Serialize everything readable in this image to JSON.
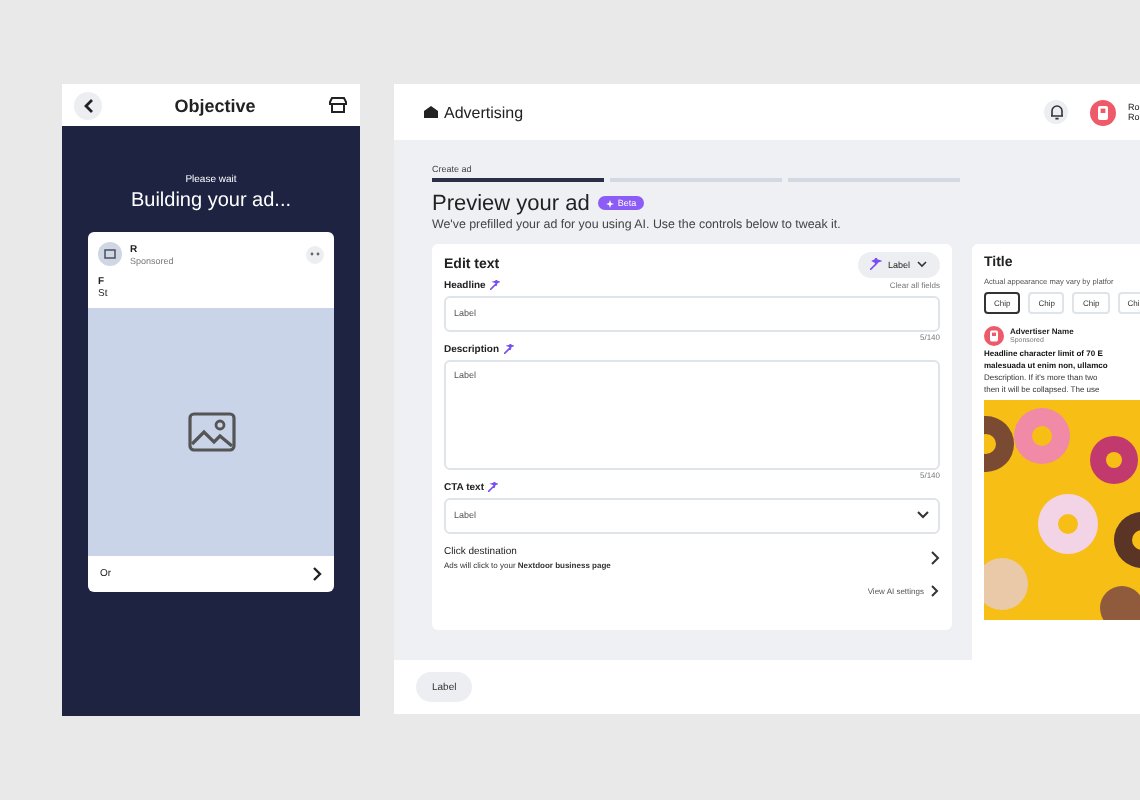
{
  "phone": {
    "title": "Objective",
    "wait_text": "Please wait",
    "heading": "Building your ad...",
    "card": {
      "name": "R",
      "meta": "Sponsored",
      "line_1": "F",
      "line_2": "St",
      "image": {
        "kind": "placeholder"
      },
      "footer": "Or"
    }
  },
  "header": {
    "title": "Advertising",
    "user_name": "Ro",
    "user_meta": "Ro"
  },
  "steps": {
    "label": "Create ad",
    "items": [
      {
        "selected": true
      },
      {
        "selected": false
      },
      {
        "selected": false
      }
    ]
  },
  "page": {
    "title": "Preview your ad",
    "badge": "Beta",
    "subtitle": "We've prefilled your ad for you using AI. Use the controls  below to tweak it."
  },
  "edit": {
    "title": "Edit text",
    "menu_label": "Label",
    "clear": "Clear all fields",
    "fields": [
      {
        "kind": "input",
        "label": "Headline",
        "value": "Label",
        "counter": "5/140"
      },
      {
        "kind": "textarea",
        "label": "Description",
        "value": "Label",
        "counter": "5/140"
      },
      {
        "kind": "select",
        "label": "CTA text",
        "value": "Label"
      }
    ],
    "destination": {
      "title": "Click destination",
      "text": "Ads will click to your **Nextdoor business page**"
    },
    "ai_link": "View AI settings"
  },
  "preview": {
    "title": "Title",
    "note": "Actual appearance may vary by platfor",
    "chips": [
      {
        "label": "Chip",
        "selected": true
      },
      {
        "label": "Chip",
        "selected": false
      },
      {
        "label": "Chip",
        "selected": false
      },
      {
        "label": "Chi",
        "selected": false
      }
    ],
    "advertiser": "Advertiser Name",
    "sponsored": "Sponsored",
    "headline_lines": [
      "Headline character limit of 70 E",
      "malesuada ut enim non, ullamco"
    ],
    "description_lines": [
      "Description. If it's more than two",
      "then it will be collapsed. The use"
    ],
    "image": {
      "kind": "picture"
    }
  },
  "footer": {
    "button": "Label"
  }
}
